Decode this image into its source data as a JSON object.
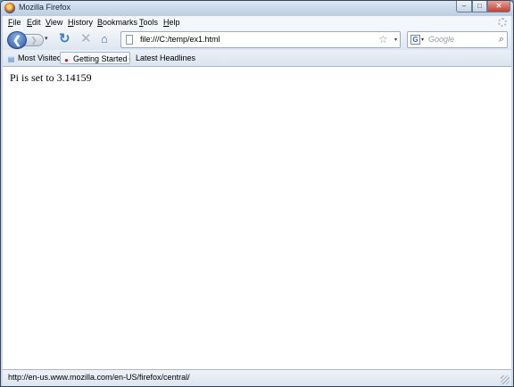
{
  "window": {
    "title": "Mozilla Firefox",
    "min_glyph": "–",
    "max_glyph": "□",
    "close_glyph": "✕"
  },
  "menu": {
    "items": [
      "File",
      "Edit",
      "View",
      "History",
      "Bookmarks",
      "Tools",
      "Help"
    ]
  },
  "navbar": {
    "back_glyph": "❮",
    "forward_glyph": "❯",
    "history_glyph": "▾",
    "reload_glyph": "↻",
    "stop_glyph": "✕",
    "home_glyph": "⌂",
    "url": "file:///C:/temp/ex1.html",
    "star_glyph": "☆",
    "url_drop_glyph": "▾",
    "search_engine_glyph": "G",
    "search_drop_glyph": "▾",
    "search_placeholder": "Google",
    "search_glyph": "⌕"
  },
  "bookmarks": [
    {
      "label": "Most Visited",
      "icon": "most-visited-icon",
      "icon_glyph": "▤",
      "color": "#4a7ac0"
    },
    {
      "label": "Getting Started",
      "icon": "firefox-bookmark-icon",
      "icon_glyph": "●",
      "color": "#c0272d"
    },
    {
      "label": "Latest Headlines",
      "icon": "rss-icon",
      "icon_glyph": "◔",
      "color": "#e8911f"
    }
  ],
  "content": {
    "text": "Pi is set to 3.14159"
  },
  "status": {
    "text": "http://en-us.www.mozilla.com/en-US/firefox/central/"
  }
}
